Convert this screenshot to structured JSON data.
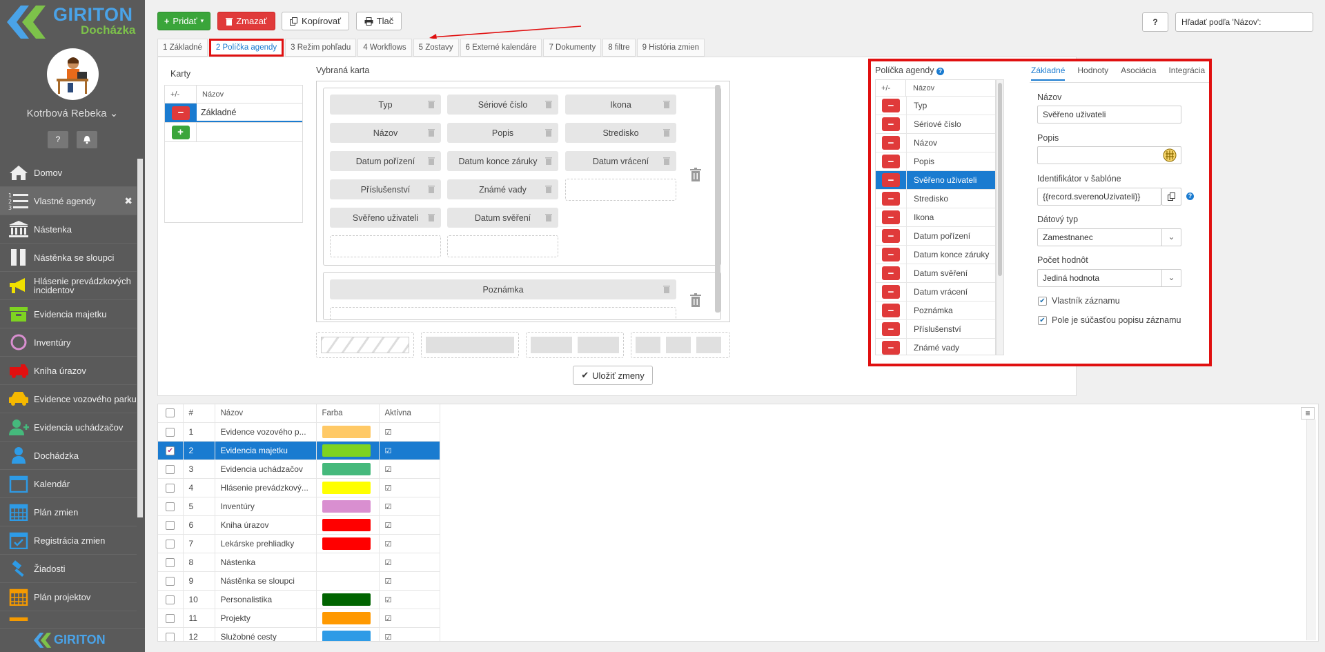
{
  "logo": {
    "brand": "GIRITON",
    "sub": "Docházka"
  },
  "user": {
    "name": "Kotrbová Rebeka"
  },
  "sidebar": {
    "items": [
      {
        "label": "Domov",
        "icon": "home-icon"
      },
      {
        "label": "Vlastné agendy",
        "icon": "list-icon",
        "close": "✖"
      },
      {
        "label": "Nástenka",
        "icon": "board-icon"
      },
      {
        "label": "Nástěnka se sloupci",
        "icon": "columns-icon"
      },
      {
        "label": "Hlásenie prevádzkových incidentov",
        "icon": "megaphone-icon"
      },
      {
        "label": "Evidencia majetku",
        "icon": "box-icon"
      },
      {
        "label": "Inventúry",
        "icon": "circle-icon"
      },
      {
        "label": "Kniha úrazov",
        "icon": "ambulance-icon"
      },
      {
        "label": "Evidence vozového parku",
        "icon": "car-icon"
      },
      {
        "label": "Evidencia uchádzačov",
        "icon": "add-user-icon"
      },
      {
        "label": "Dochádzka",
        "icon": "person-icon"
      },
      {
        "label": "Kalendár",
        "icon": "calendar-icon"
      },
      {
        "label": "Plán zmien",
        "icon": "calendar-grid-icon"
      },
      {
        "label": "Registrácia zmien",
        "icon": "calendar-check-icon"
      },
      {
        "label": "Žiadosti",
        "icon": "gavel-icon"
      },
      {
        "label": "Plán projektov",
        "icon": "calendar-orange-icon"
      },
      {
        "label": "",
        "icon": "calendar-orange-icon"
      }
    ],
    "footer": "GIRITON",
    "help": "?",
    "bell": "🔔"
  },
  "toolbar": {
    "add": "Pridať",
    "delete": "Zmazať",
    "copy": "Kopírovať",
    "print": "Tlač",
    "help": "?",
    "search_value": "Hľadať podľa 'Názov':"
  },
  "tabs": [
    "1 Základné",
    "2 Políčka agendy",
    "3 Režim pohľadu",
    "4 Workflows",
    "5 Zostavy",
    "6 Externé kalendáre",
    "7 Dokumenty",
    "8 filtre",
    "9 História zmien"
  ],
  "karty": {
    "title": "Karty",
    "col_pm": "+/-",
    "col_name": "Názov",
    "rows": [
      "Základné"
    ]
  },
  "card": {
    "title": "Vybraná karta",
    "fields": [
      "Typ",
      "Sériové číslo",
      "Ikona",
      "Názov",
      "Popis",
      "Stredisko",
      "Datum pořízení",
      "Datum konce záruky",
      "Datum vrácení",
      "Příslušenství",
      "Známé vady",
      "Svěřeno uživateli",
      "Datum svěření"
    ],
    "note": "Poznámka",
    "save": "Uložiť zmeny"
  },
  "fields_panel": {
    "title": "Políčka agendy",
    "col_pm": "+/-",
    "col_name": "Názov",
    "rows": [
      "Typ",
      "Sériové číslo",
      "Názov",
      "Popis",
      "Svěřeno uživateli",
      "Stredisko",
      "Ikona",
      "Datum pořízení",
      "Datum konce záruky",
      "Datum svěření",
      "Datum vrácení",
      "Poznámka",
      "Příslušenství",
      "Známé vady"
    ],
    "selected_row": 4
  },
  "props": {
    "tabs": [
      "Základné",
      "Hodnoty",
      "Asociácia",
      "Integrácia"
    ],
    "name_label": "Názov",
    "name_value": "Svěřeno uživateli",
    "desc_label": "Popis",
    "desc_value": "",
    "ident_label": "Identifikátor v šablóne",
    "ident_value": "{{record.sverenoUzivateli}}",
    "type_label": "Dátový typ",
    "type_value": "Zamestnanec",
    "count_label": "Počet hodnôt",
    "count_value": "Jediná hodnota",
    "owner_label": "Vlastník záznamu",
    "desc_part_label": "Pole je súčasťou popisu záznamu",
    "help": "?"
  },
  "grid": {
    "columns": [
      "#",
      "Názov",
      "Farba",
      "Aktívna"
    ],
    "rows": [
      {
        "n": "1",
        "name": "Evidence vozového p...",
        "color": "#ffc966"
      },
      {
        "n": "2",
        "name": "Evidencia majetku",
        "color": "#7ed321"
      },
      {
        "n": "3",
        "name": "Evidencia uchádzačov",
        "color": "#45b97c"
      },
      {
        "n": "4",
        "name": "Hlásenie prevádzkový...",
        "color": "#ffff00"
      },
      {
        "n": "5",
        "name": "Inventúry",
        "color": "#d98fd0"
      },
      {
        "n": "6",
        "name": "Kniha úrazov",
        "color": "#ff0000"
      },
      {
        "n": "7",
        "name": "Lekárske prehliadky",
        "color": "#ff0000"
      },
      {
        "n": "8",
        "name": "Nástenka",
        "color": "#ffffff"
      },
      {
        "n": "9",
        "name": "Nástěnka se sloupci",
        "color": ""
      },
      {
        "n": "10",
        "name": "Personalistika",
        "color": "#006400"
      },
      {
        "n": "11",
        "name": "Projekty",
        "color": "#ff9900"
      },
      {
        "n": "12",
        "name": "Služobné cesty",
        "color": "#2e9be6"
      }
    ],
    "selected_row": 1,
    "menu": "≡"
  }
}
